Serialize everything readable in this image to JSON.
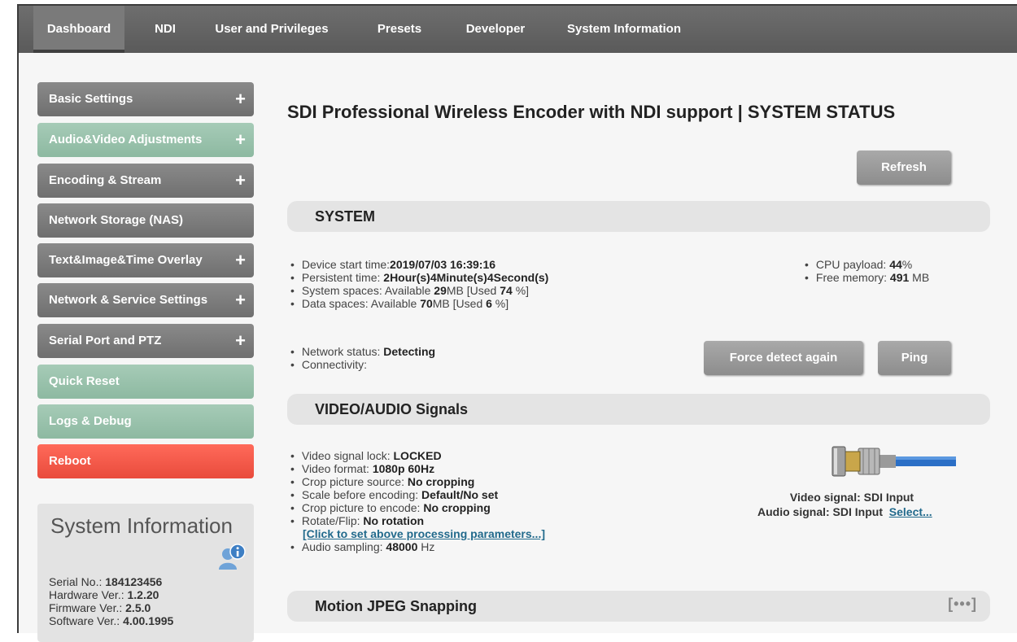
{
  "nav": {
    "tabs": [
      {
        "label": "Dashboard"
      },
      {
        "label": "NDI"
      },
      {
        "label": "User and Privileges"
      },
      {
        "label": "Presets"
      },
      {
        "label": "Developer"
      },
      {
        "label": "System Information"
      }
    ]
  },
  "sidebar": {
    "items": [
      {
        "label": "Basic Settings",
        "plus": "+"
      },
      {
        "label": "Audio&Video Adjustments",
        "plus": "+"
      },
      {
        "label": "Encoding & Stream",
        "plus": "+"
      },
      {
        "label": "Network Storage (NAS)"
      },
      {
        "label": "Text&Image&Time Overlay",
        "plus": "+"
      },
      {
        "label": "Network & Service Settings",
        "plus": "+"
      },
      {
        "label": "Serial Port and PTZ",
        "plus": "+"
      },
      {
        "label": "Quick Reset"
      },
      {
        "label": "Logs & Debug"
      },
      {
        "label": "Reboot"
      }
    ],
    "system_info": {
      "title": "System Information",
      "serial_label": "Serial No.: ",
      "serial": "184123456",
      "hw_label": "Hardware Ver.: ",
      "hw": "1.2.20",
      "fw_label": "Firmware Ver.: ",
      "fw": "2.5.0",
      "sw_label": "Software Ver.: ",
      "sw": "4.00.1995"
    }
  },
  "main": {
    "title": "SDI Professional Wireless Encoder with NDI support | SYSTEM STATUS",
    "refresh_label": "Refresh",
    "system": {
      "heading": "SYSTEM",
      "start_label": "Device start time:",
      "start": "2019/07/03 16:39:16",
      "persist_label": "Persistent time: ",
      "persist": "2Hour(s)4Minute(s)4Second(s)",
      "sys_label": "System spaces: Available ",
      "sys_avail": "29",
      "sys_mid": "MB [Used ",
      "sys_used": "74",
      "sys_end": " %]",
      "data_label": "Data spaces: Available ",
      "data_avail": "70",
      "data_mid": "MB [Used ",
      "data_used": "6",
      "data_end": " %]",
      "cpu_label": "CPU payload: ",
      "cpu": "44",
      "cpu_unit": "%",
      "mem_label": "Free memory: ",
      "mem": "491",
      "mem_unit": " MB",
      "net_label": "Network status: ",
      "net": "Detecting",
      "conn_label": "Connectivity:",
      "force_label": "Force detect again",
      "ping_label": "Ping"
    },
    "av": {
      "heading": "VIDEO/AUDIO Signals",
      "lock_label": "Video signal lock: ",
      "lock": "LOCKED",
      "format_label": "Video format: ",
      "format": "1080p 60Hz",
      "crop_src_label": "Crop picture source: ",
      "crop_src": "No cropping",
      "scale_label": "Scale before encoding: ",
      "scale": "Default/No set",
      "crop_enc_label": "Crop picture to encode: ",
      "crop_enc": "No cropping",
      "rotate_label": "Rotate/Flip: ",
      "rotate": "No rotation",
      "click_link": "[Click to set above processing parameters...]",
      "audio_label": "Audio sampling: ",
      "audio": "48000",
      "audio_unit": " Hz",
      "video_signal": "Video signal: SDI Input",
      "audio_signal": "Audio signal: SDI Input",
      "select_link": "Select..."
    },
    "mjpeg": {
      "heading": "Motion JPEG Snapping",
      "more": "[•••]"
    }
  }
}
